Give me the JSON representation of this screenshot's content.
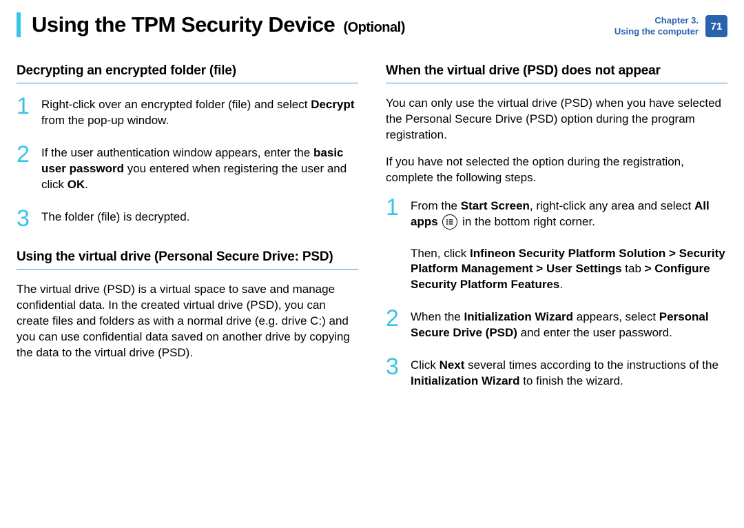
{
  "header": {
    "title": "Using the TPM Security Device",
    "suffix": "(Optional)",
    "chapter_line1": "Chapter 3.",
    "chapter_line2": "Using the computer",
    "page_number": "71"
  },
  "left": {
    "section1_title": "Decrypting an encrypted folder (file)",
    "steps1": [
      {
        "n": "1",
        "html": "Right-click over an encrypted folder (file) and select <b>Decrypt</b> from the pop-up window."
      },
      {
        "n": "2",
        "html": "If the user authentication window appears, enter the <b>basic user password</b> you entered when registering the user and click <b>OK</b>."
      },
      {
        "n": "3",
        "html": "The folder (file) is decrypted."
      }
    ],
    "section2_title": "Using the virtual drive (Personal Secure Drive: PSD)",
    "para2": "The virtual drive (PSD) is a virtual space to save and manage confidential data. In the created virtual drive (PSD), you can create files and folders as with a normal drive (e.g. drive C:) and you can use confidential data saved on another drive by copying the data to the virtual drive (PSD)."
  },
  "right": {
    "section_title": "When the virtual drive (PSD) does not appear",
    "para1": "You can only use the virtual drive (PSD) when you have selected the Personal Secure Drive (PSD) option during the program registration.",
    "para2": " If you have not selected the option during the registration, complete the following steps.",
    "steps": [
      {
        "n": "1",
        "html": "From the <b>Start Screen</b>, right-click any area and select <b>All apps</b> <span class=\"allapps-icon\" data-name=\"all-apps-icon\" data-interactable=\"false\"><svg width=\"12\" height=\"12\" viewBox=\"0 0 12 12\"><circle cx=\"2\" cy=\"3\" r=\"1\" fill=\"#000\"/><rect x=\"4.5\" y=\"2.3\" width=\"6\" height=\"1.3\" fill=\"#000\"/><circle cx=\"2\" cy=\"6\" r=\"1\" fill=\"#000\"/><rect x=\"4.5\" y=\"5.3\" width=\"6\" height=\"1.3\" fill=\"#000\"/><circle cx=\"2\" cy=\"9\" r=\"1\" fill=\"#000\"/><rect x=\"4.5\" y=\"8.3\" width=\"6\" height=\"1.3\" fill=\"#000\"/></svg></span> in the bottom right corner.<br><br>Then, click <b>Infineon Security Platform Solution > Security Platform Management > User Settings</b> tab <b>> Configure Security Platform Features</b>."
      },
      {
        "n": "2",
        "html": "When the <b>Initialization Wizard</b> appears, select <b>Personal Secure Drive (PSD)</b> and enter the user password."
      },
      {
        "n": "3",
        "html": "Click <b>Next</b> several times according to the instructions of the <b>Initialization Wizard</b> to finish the wizard."
      }
    ]
  }
}
